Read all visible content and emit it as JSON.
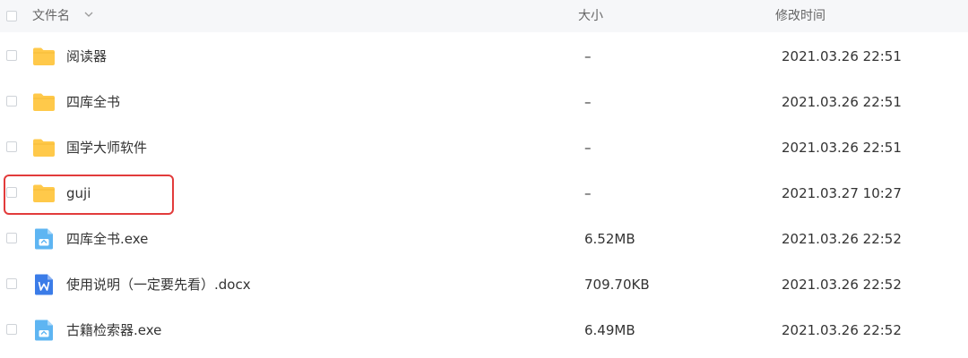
{
  "header": {
    "name_label": "文件名",
    "size_label": "大小",
    "modified_label": "修改时间"
  },
  "files": [
    {
      "name": "阅读器",
      "size": "–",
      "modified": "2021.03.26 22:51",
      "type": "folder"
    },
    {
      "name": "四库全书",
      "size": "–",
      "modified": "2021.03.26 22:51",
      "type": "folder"
    },
    {
      "name": "国学大师软件",
      "size": "–",
      "modified": "2021.03.26 22:51",
      "type": "folder"
    },
    {
      "name": "guji",
      "size": "–",
      "modified": "2021.03.27 10:27",
      "type": "folder"
    },
    {
      "name": "四库全书.exe",
      "size": "6.52MB",
      "modified": "2021.03.26 22:52",
      "type": "exe"
    },
    {
      "name": "使用说明（一定要先看）.docx",
      "size": "709.70KB",
      "modified": "2021.03.26 22:52",
      "type": "docx"
    },
    {
      "name": "古籍检索器.exe",
      "size": "6.49MB",
      "modified": "2021.03.26 22:52",
      "type": "exe"
    }
  ],
  "icons": {
    "folder": "folder-icon",
    "exe": "exe-file-icon",
    "docx": "word-document-icon",
    "sort": "chevron-down-icon"
  },
  "colors": {
    "folder": "#FFC94A",
    "exe": "#5EB5F2",
    "docx": "#3B7CE8",
    "highlight": "#E23B3B"
  }
}
